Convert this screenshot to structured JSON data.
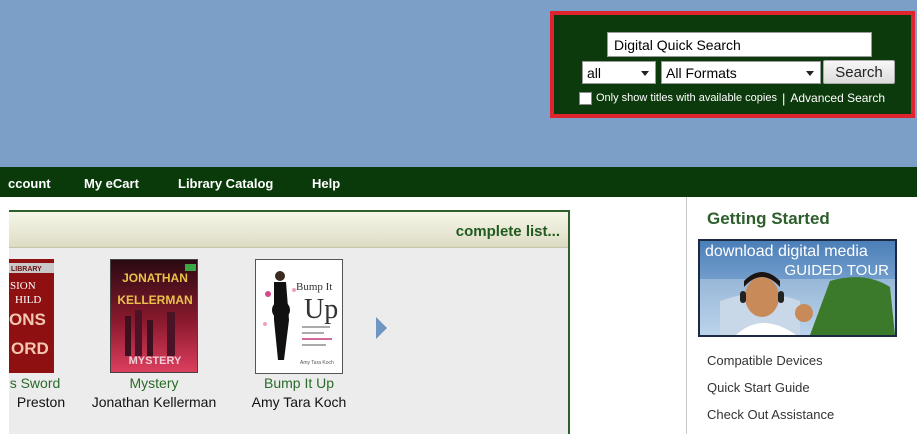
{
  "search": {
    "input_value": "Digital Quick Search",
    "scope_selected": "all",
    "format_selected": "All Formats",
    "button_label": "Search",
    "available_label": "Only show titles with available copies",
    "separator": "|",
    "advanced_label": "Advanced Search",
    "checkbox_checked": false
  },
  "nav": {
    "items": [
      "ccount",
      "My eCart",
      "Library Catalog",
      "Help"
    ]
  },
  "panel": {
    "complete_list_label": "complete list...",
    "books": [
      {
        "title": "s Sword",
        "author": "Preston",
        "cover_text": [
          "LIBRARY",
          "SION",
          "HILD",
          "ONS",
          "ORD"
        ]
      },
      {
        "title": "Mystery",
        "author": "Jonathan Kellerman",
        "cover_text": [
          "JONATHAN",
          "KELLERMAN",
          "MYSTERY"
        ]
      },
      {
        "title": "Bump It Up",
        "author": "Amy Tara Koch",
        "cover_text": [
          "Bump It",
          "Up",
          "Amy Tara Koch"
        ]
      }
    ]
  },
  "sidebar": {
    "heading": "Getting Started",
    "banner_line1": "download digital media",
    "banner_line2": "GUIDED TOUR",
    "links": [
      "Compatible Devices",
      "Quick Start Guide",
      "Check Out Assistance"
    ]
  },
  "colors": {
    "top_band": "#7b9fc7",
    "search_highlight": "#e0242f",
    "nav_bg": "#0a3a0a",
    "accent_green": "#2d5f2d"
  }
}
